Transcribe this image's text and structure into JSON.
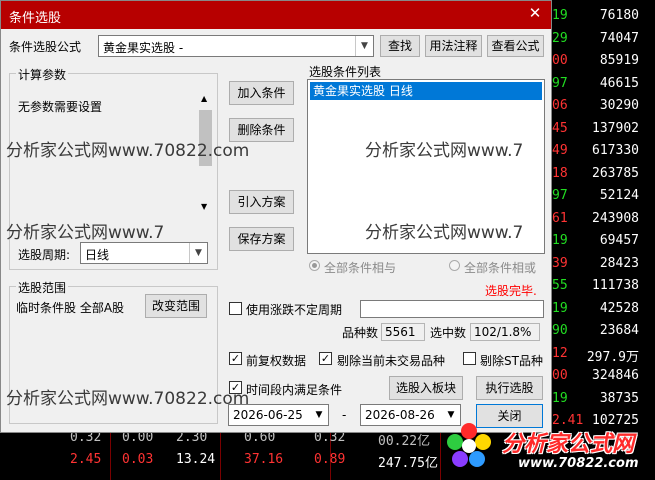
{
  "background": {
    "right_rows": [
      {
        "left": "19",
        "right": "76180",
        "color": "green"
      },
      {
        "left": "29",
        "right": "74047",
        "color": "green"
      },
      {
        "left": "00",
        "right": "85919",
        "color": "red"
      },
      {
        "left": "97",
        "right": "46615",
        "color": "green"
      },
      {
        "left": "06",
        "right": "30290",
        "color": "red"
      },
      {
        "left": "45",
        "right": "137902",
        "color": "red"
      },
      {
        "left": "49",
        "right": "617330",
        "color": "red"
      },
      {
        "left": "18",
        "right": "263785",
        "color": "red"
      },
      {
        "left": "97",
        "right": "52124",
        "color": "green"
      },
      {
        "left": "61",
        "right": "243908",
        "color": "red"
      },
      {
        "left": "19",
        "right": "69457",
        "color": "green"
      },
      {
        "left": "39",
        "right": "28423",
        "color": "red"
      },
      {
        "left": "55",
        "right": "111738",
        "color": "green"
      },
      {
        "left": "19",
        "right": "42528",
        "color": "green"
      },
      {
        "left": "90",
        "right": "23684",
        "color": "green"
      },
      {
        "left": "12",
        "right": "297.9万",
        "color": "red"
      },
      {
        "left": "00",
        "right": "324846",
        "color": "red"
      },
      {
        "left": "19",
        "right": "38735",
        "color": "green"
      },
      {
        "left": "2.41",
        "right": "102725",
        "color": "red"
      }
    ],
    "bottom_row_1": [
      "0.32",
      "0.00",
      "2.30",
      "0.60",
      "0.32",
      "00.22亿"
    ],
    "bottom_row_2": [
      "2.45",
      "0.03",
      "13.24",
      "37.16",
      "0.89",
      "247.75亿"
    ]
  },
  "watermarks": [
    "分析家公式网www.70822.com",
    "分析家公式网www.7",
    "分析家公式网www.7",
    "分析家公式网www.70822.com",
    "分析家公式网www.7"
  ],
  "dialog": {
    "title": "条件选股",
    "formula_label": "条件选股公式",
    "formula_value": "黄金果实选股  -",
    "buttons": {
      "find": "查找",
      "usage": "用法注释",
      "view_formula": "查看公式",
      "add_condition": "加入条件",
      "delete_condition": "删除条件",
      "import_plan": "引入方案",
      "save_plan": "保存方案",
      "change_range": "改变范围",
      "select_to_block": "选股入板块",
      "execute": "执行选股",
      "close": "关闭"
    },
    "params_group": {
      "title": "计算参数",
      "text": "无参数需要设置"
    },
    "period_label": "选股周期:",
    "period_value": "日线",
    "condition_list": {
      "title": "选股条件列表",
      "items": [
        "黄金果实选股  日线"
      ]
    },
    "radio_and": "全部条件相与",
    "radio_or": "全部条件相或",
    "status": "选股完毕.",
    "status_color": "#ff0000",
    "range_group": {
      "title": "选股范围",
      "text": "临时条件股 全部A股"
    },
    "use_rise_fall_label": "使用涨跌不定周期",
    "use_rise_fall_checked": false,
    "variety_count_label": "品种数",
    "variety_count": "5561",
    "hit_label": "选中数",
    "hit_value": "102/1.8%",
    "forward_adjust_label": "前复权数据",
    "forward_adjust_checked": true,
    "exclude_untraded_label": "剔除当前未交易品种",
    "exclude_untraded_checked": true,
    "exclude_st_label": "剔除ST品种",
    "exclude_st_checked": false,
    "time_range_label": "时间段内满足条件",
    "time_range_checked": true,
    "date_from": "2026-06-25",
    "date_sep": "-",
    "date_to": "2026-08-26"
  },
  "logo": {
    "brand": "分析家公式网",
    "url": "www.70822.com"
  }
}
